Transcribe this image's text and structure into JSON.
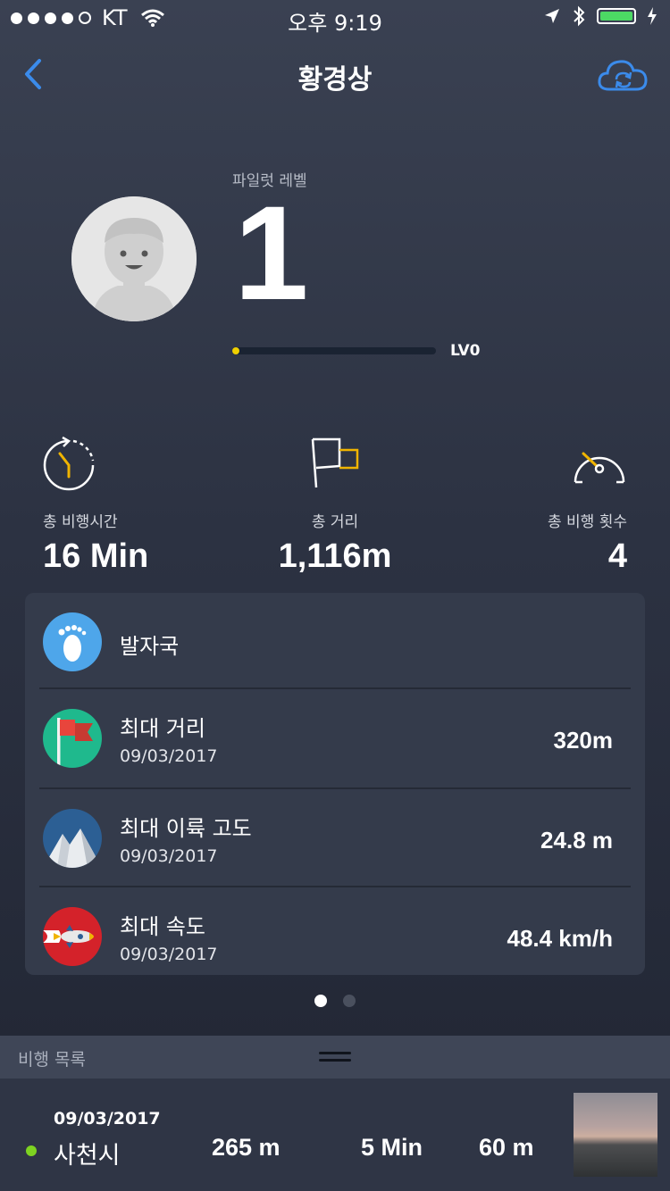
{
  "status_bar": {
    "carrier": "KT",
    "time": "오후 9:19"
  },
  "nav": {
    "title": "황경상"
  },
  "profile": {
    "pilot_label": "파일럿 레벨",
    "level": "1",
    "level_tag": "LV0",
    "progress": 0.0
  },
  "stats": [
    {
      "label": "총 비행시간",
      "value": "16 Min",
      "icon": "stopwatch-icon"
    },
    {
      "label": "총 거리",
      "value": "1,116m",
      "icon": "flag-icon"
    },
    {
      "label": "총 비행 횟수",
      "value": "4",
      "icon": "speedometer-icon"
    }
  ],
  "records": [
    {
      "title": "발자국",
      "date": "",
      "value": "",
      "icon": "footprint-icon"
    },
    {
      "title": "최대 거리",
      "date": "09/03/2017",
      "value": "320m",
      "icon": "red-flag-icon"
    },
    {
      "title": "최대 이륙 고도",
      "date": "09/03/2017",
      "value": "24.8 m",
      "icon": "mountain-icon"
    },
    {
      "title": "최대 속도",
      "date": "09/03/2017",
      "value": "48.4 km/h",
      "icon": "rocket-icon"
    }
  ],
  "pager": {
    "pages": 2,
    "active": 0
  },
  "flight_list": {
    "header": "비행 목록",
    "items": [
      {
        "date": "09/03/2017",
        "place": "사천시",
        "distance": "265 m",
        "duration": "5 Min",
        "altitude": "60 m"
      }
    ]
  },
  "colors": {
    "accent_blue": "#3b8beb",
    "accent_yellow": "#f0b400",
    "progress_yellow": "#f0d000",
    "online_green": "#7ed321",
    "battery_green": "#4cd964"
  }
}
